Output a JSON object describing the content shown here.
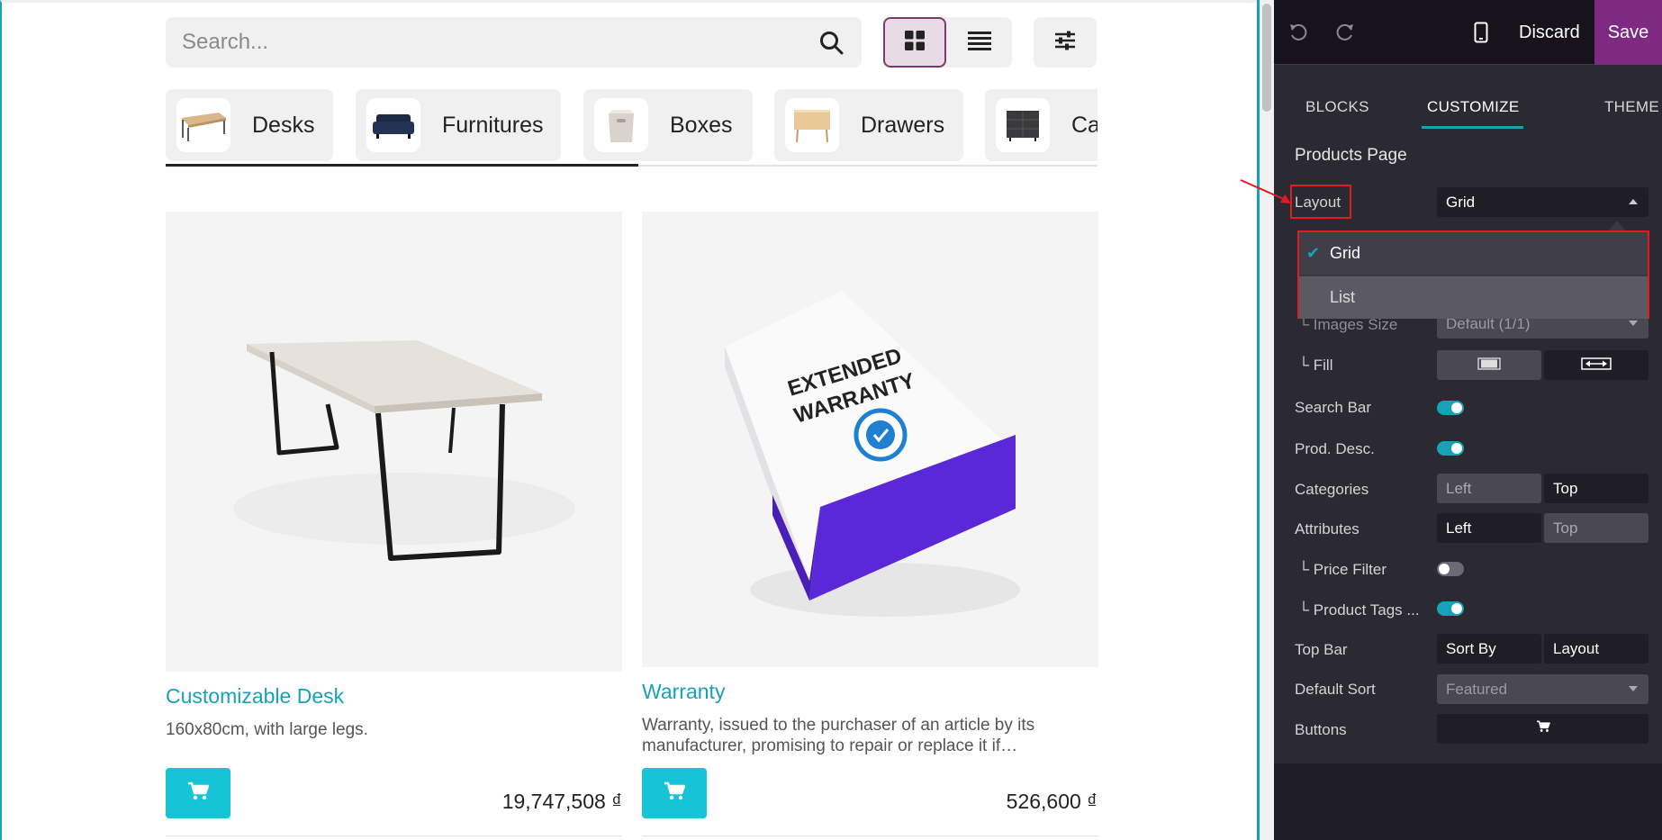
{
  "website": {
    "search": {
      "placeholder": "Search..."
    },
    "view_toggle": {
      "grid_icon": "grid-view-icon",
      "list_icon": "list-view-icon"
    },
    "filter_icon": "sliders-icon",
    "categories": [
      {
        "label": "Desks",
        "icon": "desk-thumbnail"
      },
      {
        "label": "Furnitures",
        "icon": "sofa-thumbnail"
      },
      {
        "label": "Boxes",
        "icon": "box-thumbnail"
      },
      {
        "label": "Drawers",
        "icon": "drawer-thumbnail"
      },
      {
        "label": "Ca",
        "icon": "cabinet-thumbnail"
      }
    ],
    "products": [
      {
        "name": "Customizable Desk",
        "description": "160x80cm, with large legs.",
        "price": "19,747,508 ₫"
      },
      {
        "name": "Warranty",
        "description": "Warranty, issued to the purchaser of an article by its manufacturer, promising to repair or replace it if…",
        "price": "526,600 ₫",
        "box_text": [
          "EXTENDED",
          "WARRANTY"
        ]
      }
    ]
  },
  "editor": {
    "toolbar": {
      "discard_label": "Discard",
      "save_label": "Save"
    },
    "tabs": {
      "blocks": "BLOCKS",
      "customize": "CUSTOMIZE",
      "theme": "THEME"
    },
    "section_title": "Products Page",
    "layout": {
      "label": "Layout",
      "value": "Grid",
      "options": [
        "Grid",
        "List"
      ],
      "selected": "Grid"
    },
    "images_size": {
      "label": "└ Images Size",
      "value": "Default (1/1)"
    },
    "fill": {
      "label": "└ Fill"
    },
    "search_bar": {
      "label": "Search Bar",
      "on": true
    },
    "prod_desc": {
      "label": "Prod. Desc.",
      "on": true
    },
    "categories": {
      "label": "Categories",
      "left": "Left",
      "top": "Top"
    },
    "attributes": {
      "label": "Attributes",
      "left": "Left",
      "top": "Top"
    },
    "price_filter": {
      "label": "└ Price Filter",
      "on": false
    },
    "product_tags": {
      "label": "└ Product Tags ...",
      "on": true
    },
    "top_bar": {
      "label": "Top Bar",
      "sort_by": "Sort By",
      "layout": "Layout"
    },
    "default_sort": {
      "label": "Default Sort",
      "value": "Featured"
    },
    "buttons": {
      "label": "Buttons"
    }
  },
  "colors": {
    "accent": "#17a2b8",
    "save": "#7e2a83",
    "annotation": "#e21b23"
  }
}
